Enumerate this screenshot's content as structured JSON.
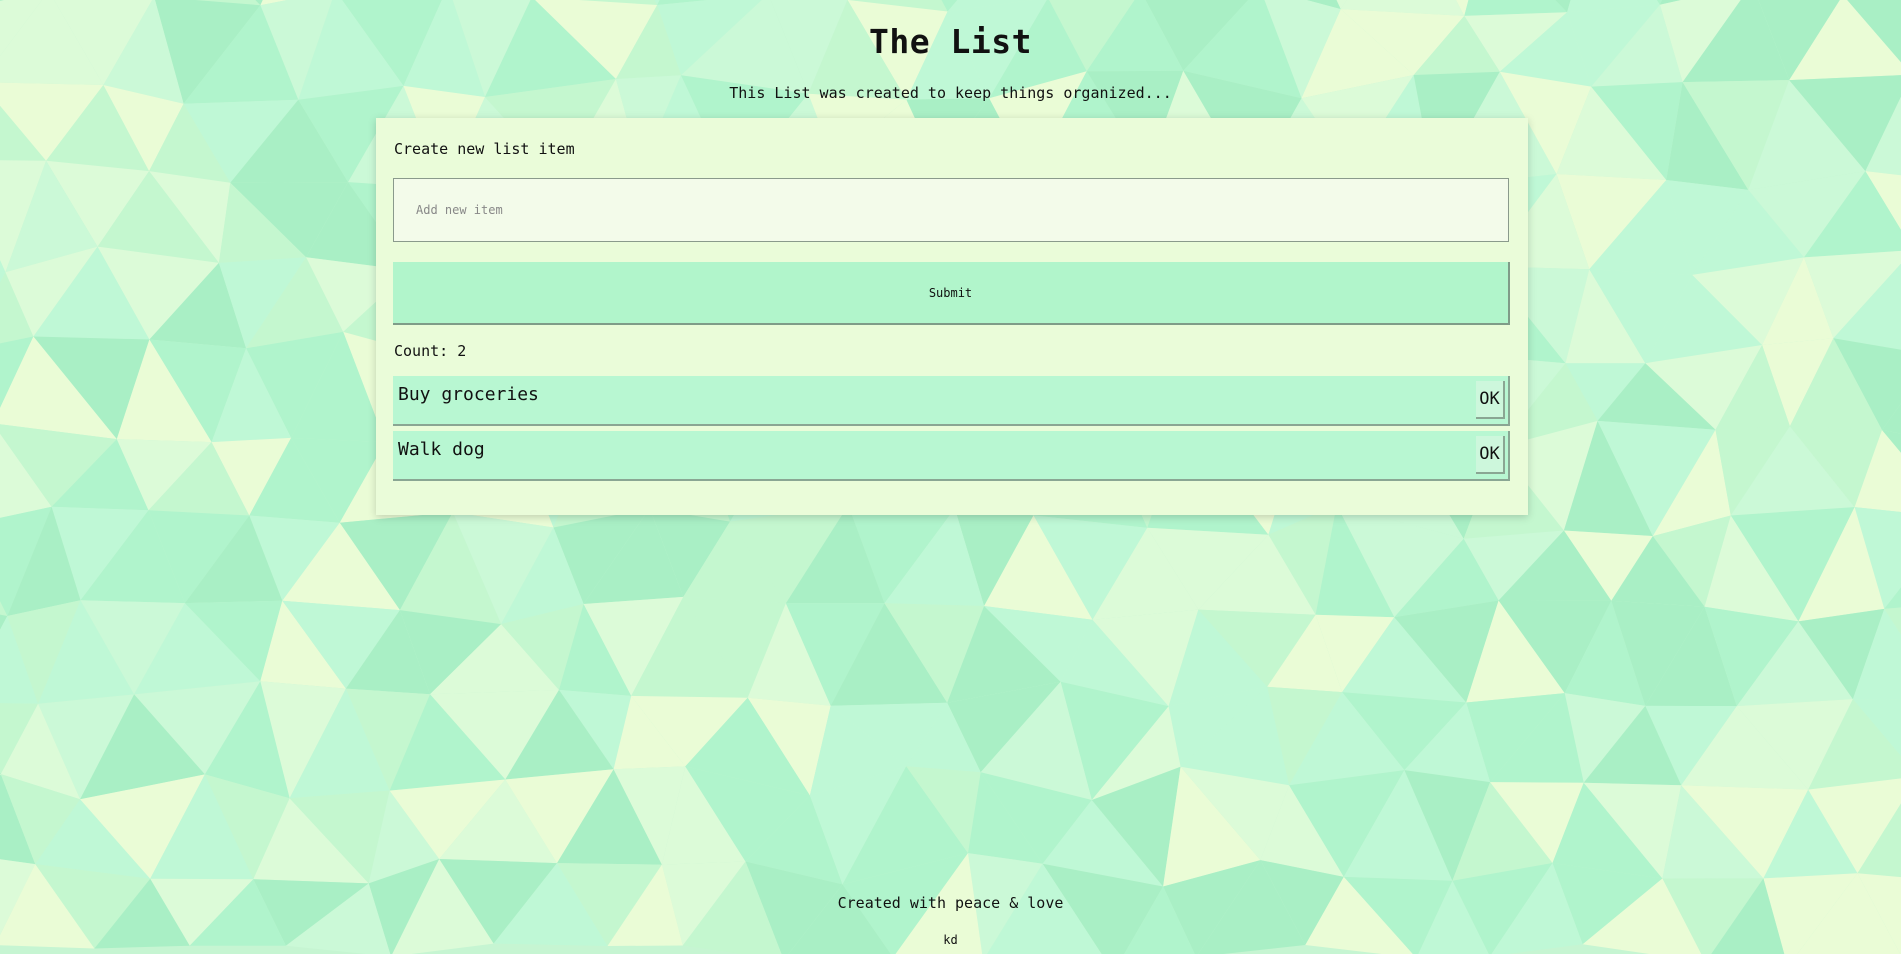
{
  "theme": {
    "card_bg": "#eafcd9",
    "accent": "#b1f5cb",
    "item_bg": "#b8f7d2",
    "pattern_colors": [
      "#b0f4cc",
      "#bff8d6",
      "#cbf9d7",
      "#dcfbd8",
      "#eafcd6",
      "#a9efc5",
      "#c4f7cf"
    ]
  },
  "header": {
    "title": "The List",
    "subtitle": "This List was created to keep things organized..."
  },
  "form": {
    "heading": "Create new list item",
    "input_placeholder": "Add new item",
    "input_value": "",
    "submit_label": "Submit"
  },
  "count": {
    "text": "Count: 2"
  },
  "items": [
    {
      "text": "Buy groceries",
      "action_label": "OK"
    },
    {
      "text": "Walk dog",
      "action_label": "OK"
    }
  ],
  "footer": {
    "text": "Created with peace & love",
    "author": "kd"
  }
}
